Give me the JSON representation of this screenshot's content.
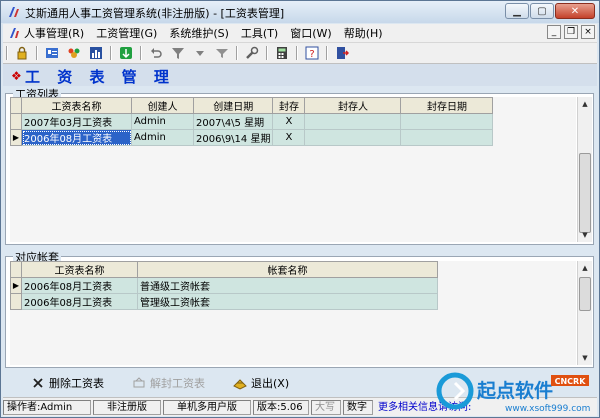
{
  "window": {
    "title": "艾斯通用人事工资管理系统(非注册版) - [工资表管理]"
  },
  "menu": [
    "人事管理(R)",
    "工资管理(G)",
    "系统维护(S)",
    "工具(T)",
    "窗口(W)",
    "帮助(H)"
  ],
  "mdi_buttons": [
    "_",
    "❐",
    "×"
  ],
  "header": {
    "title": "工 资 表 管 理"
  },
  "salary_list": {
    "label": "工资列表",
    "columns": [
      "工资表名称",
      "创建人",
      "创建日期",
      "封存",
      "封存人",
      "封存日期"
    ],
    "rows": [
      {
        "indicator": "",
        "name": "2007年03月工资表",
        "creator": "Admin",
        "date": "2007\\4\\5 星期",
        "sealed": "X",
        "sealer": "",
        "seal_date": ""
      },
      {
        "indicator": "▶",
        "name": "2006年08月工资表",
        "creator": "Admin",
        "date": "2006\\9\\14 星期",
        "sealed": "X",
        "sealer": "",
        "seal_date": ""
      }
    ]
  },
  "account_sets": {
    "label": "对应帐套",
    "columns": [
      "工资表名称",
      "帐套名称"
    ],
    "rows": [
      {
        "indicator": "▶",
        "name": "2006年08月工资表",
        "set": "普通级工资帐套"
      },
      {
        "indicator": "",
        "name": "2006年08月工资表",
        "set": "管理级工资帐套"
      }
    ]
  },
  "actions": {
    "delete": "删除工资表",
    "unseal": "解封工资表",
    "exit": "退出(X)"
  },
  "status": {
    "operator": "操作者:Admin",
    "license": "非注册版",
    "mode": "单机多用户版",
    "version": "版本:5.06",
    "caps": "大写",
    "num": "数字",
    "link": "更多相关信息请访问:"
  },
  "watermark": {
    "brand": "起点软件",
    "tag": "CNCRK",
    "url": "www.xsoft999.com"
  },
  "colors": {
    "header_text": "#0033cc",
    "grid_row": "#cfe5e0",
    "selected_cell": "#2b63c8",
    "link": "#0000cc"
  }
}
